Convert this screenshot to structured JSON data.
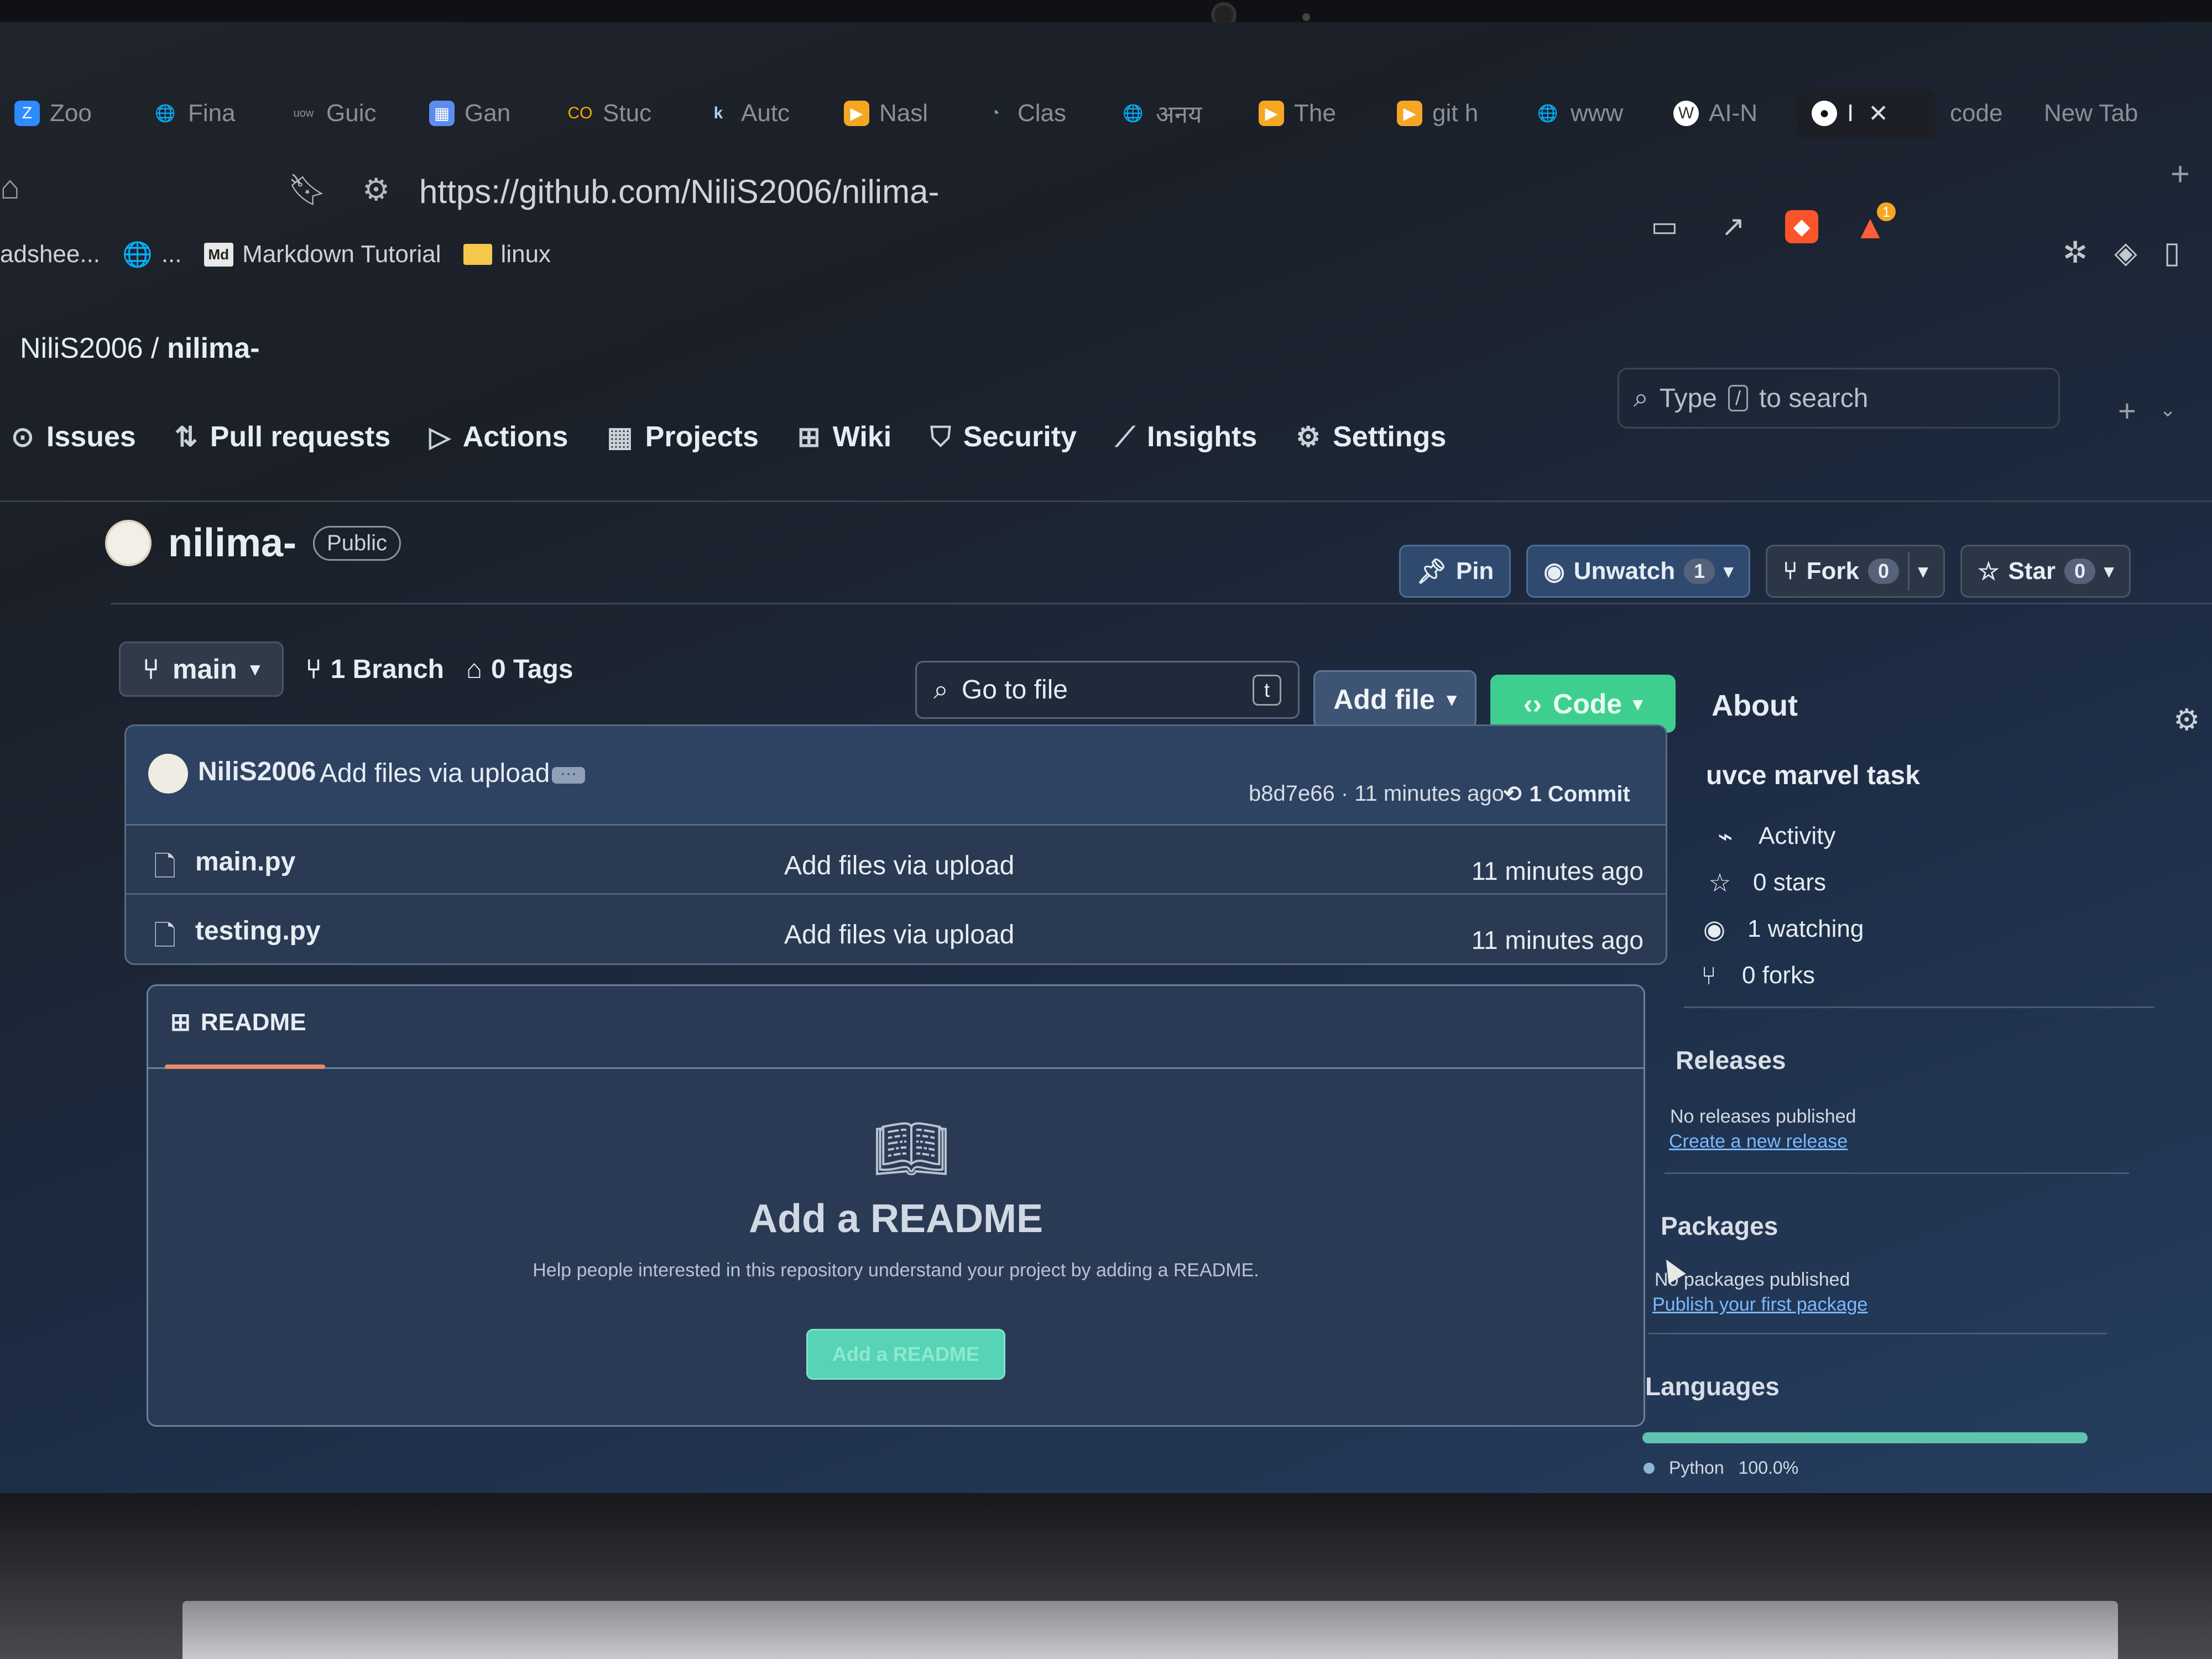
{
  "browser": {
    "tabs": [
      {
        "label": "Zoo",
        "icon": "zoom-icon"
      },
      {
        "label": "Fina",
        "icon": "globe-icon"
      },
      {
        "label": "Guic",
        "icon": "uow-icon"
      },
      {
        "label": "Gan",
        "icon": "gantt-icon"
      },
      {
        "label": "Stuc",
        "icon": "colab-icon"
      },
      {
        "label": "Autc",
        "icon": "k-icon"
      },
      {
        "label": "Nasl",
        "icon": "youtube-icon"
      },
      {
        "label": "Clas",
        "icon": "class-icon"
      },
      {
        "label": "अनय",
        "icon": "globe-icon"
      },
      {
        "label": "The",
        "icon": "youtube-icon"
      },
      {
        "label": "git h",
        "icon": "youtube-icon"
      },
      {
        "label": "www",
        "icon": "globe-icon"
      },
      {
        "label": "AI-N",
        "icon": "ai-icon"
      },
      {
        "label": "I",
        "icon": "github-icon",
        "active": true
      },
      {
        "label": "code",
        "icon": ""
      },
      {
        "label": "New Tab",
        "icon": ""
      }
    ],
    "url": "https://github.com/NiliS2006/nilima-",
    "bookmarks": [
      {
        "label": "adshee...",
        "icon": ""
      },
      {
        "label": "...",
        "icon": "globe-icon"
      },
      {
        "label": "Markdown Tutorial",
        "icon": "md-icon"
      },
      {
        "label": "linux",
        "icon": "folder-icon"
      }
    ],
    "bat_badge": "1"
  },
  "github": {
    "owner": "NiliS2006",
    "crumb_sep": "/",
    "repo": "nilima-",
    "search_pre": "Type",
    "search_key": "/",
    "search_post": "to search",
    "nav": [
      "Issues",
      "Pull requests",
      "Actions",
      "Projects",
      "Wiki",
      "Security",
      "Insights",
      "Settings"
    ],
    "visibility": "Public",
    "actions": {
      "pin": "Pin",
      "unwatch": "Unwatch",
      "unwatch_count": "1",
      "fork": "Fork",
      "fork_count": "0",
      "star": "Star",
      "star_count": "0"
    },
    "branch": "main",
    "branches": "1 Branch",
    "tags": "0 Tags",
    "goto_file": "Go to file",
    "goto_key": "t",
    "add_file": "Add file",
    "code": "Code",
    "commit": {
      "author": "NiliS2006",
      "message": "Add files via upload",
      "hash_time": "b8d7e66 · 11 minutes ago",
      "count": "1 Commit"
    },
    "files": [
      {
        "name": "main.py",
        "message": "Add files via upload",
        "time": "11 minutes ago"
      },
      {
        "name": "testing.py",
        "message": "Add files via upload",
        "time": "11 minutes ago"
      }
    ],
    "readme": {
      "tab": "README",
      "title": "Add a README",
      "desc": "Help people interested in this repository understand your project by adding a README.",
      "button": "Add a README"
    },
    "about": {
      "title": "About",
      "desc": "uvce marvel task",
      "stats": [
        "Activity",
        "0 stars",
        "1 watching",
        "0 forks"
      ]
    },
    "releases": {
      "title": "Releases",
      "text": "No releases published",
      "link": "Create a new release"
    },
    "packages": {
      "title": "Packages",
      "text": "No packages published",
      "link": "Publish your first package"
    },
    "languages": {
      "title": "Languages",
      "name": "Python",
      "percent": "100.0%",
      "value": 100
    }
  }
}
